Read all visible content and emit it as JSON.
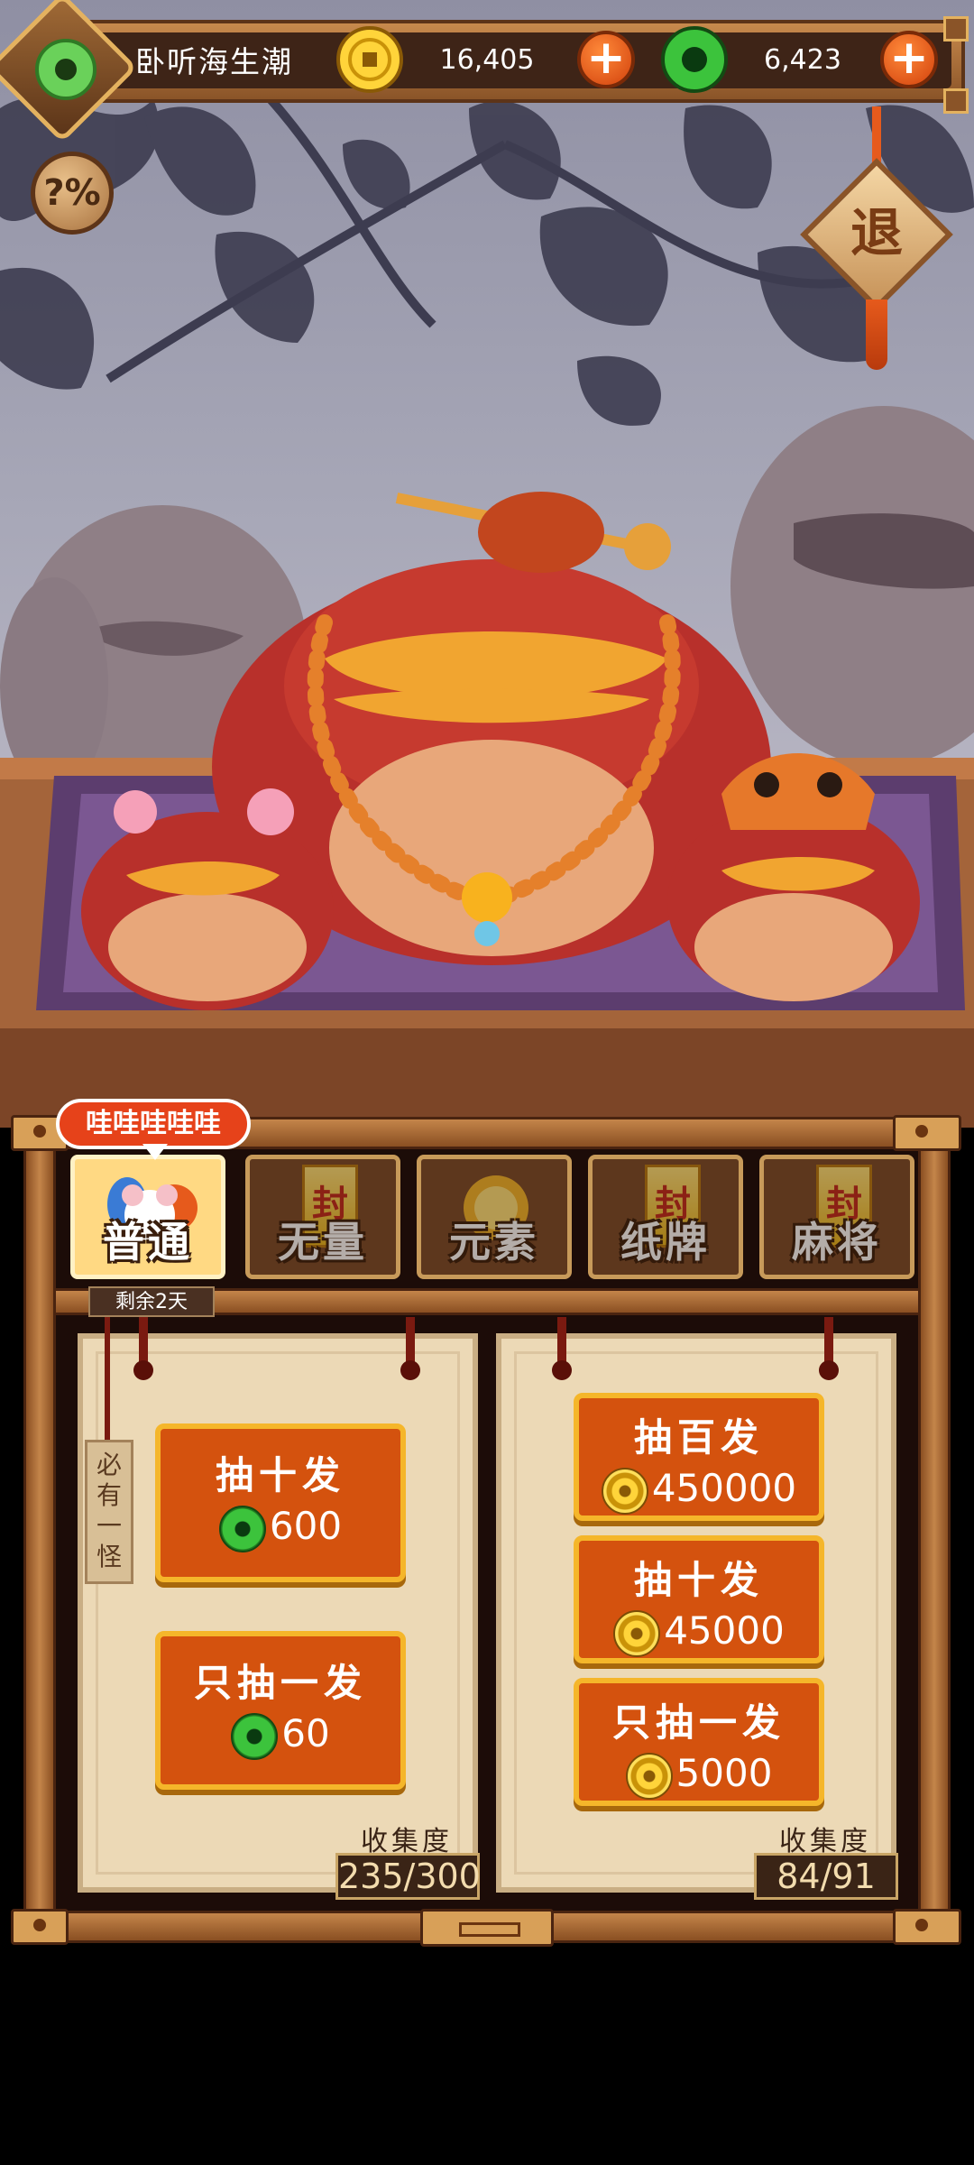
{
  "player": {
    "name": "卧听海生潮"
  },
  "currency": {
    "gold": {
      "value": "16,405",
      "icon": "gold-coin-icon"
    },
    "jade": {
      "value": "6,423",
      "icon": "jade-coin-icon"
    }
  },
  "controls": {
    "rate_label": "?%",
    "exit_label": "退"
  },
  "tabs": [
    {
      "label": "普通",
      "active": true,
      "art": "mouse-icon"
    },
    {
      "label": "无量",
      "active": false,
      "lock": "封"
    },
    {
      "label": "元素",
      "active": false
    },
    {
      "label": "纸牌",
      "active": false,
      "lock": "封"
    },
    {
      "label": "麻将",
      "active": false,
      "lock": "封"
    }
  ],
  "tab_badge": "哇哇哇哇哇",
  "remaining": "剩余2天",
  "side_tag": "必有一怪",
  "left_pool": {
    "buttons": [
      {
        "label": "抽十发",
        "cost": "600",
        "currency": "jade"
      },
      {
        "label": "只抽一发",
        "cost": "60",
        "currency": "jade"
      }
    ],
    "collection_label": "收集度",
    "collection_value": "235/300"
  },
  "right_pool": {
    "buttons": [
      {
        "label": "抽百发",
        "cost": "450000",
        "currency": "gold"
      },
      {
        "label": "抽十发",
        "cost": "45000",
        "currency": "gold"
      },
      {
        "label": "只抽一发",
        "cost": "5000",
        "currency": "gold"
      }
    ],
    "collection_label": "收集度",
    "collection_value": "84/91"
  },
  "colors": {
    "accent_orange": "#d4520e",
    "button_border": "#f5b62a",
    "wood": "#8a4f22",
    "parchment": "#ecd9b6"
  }
}
